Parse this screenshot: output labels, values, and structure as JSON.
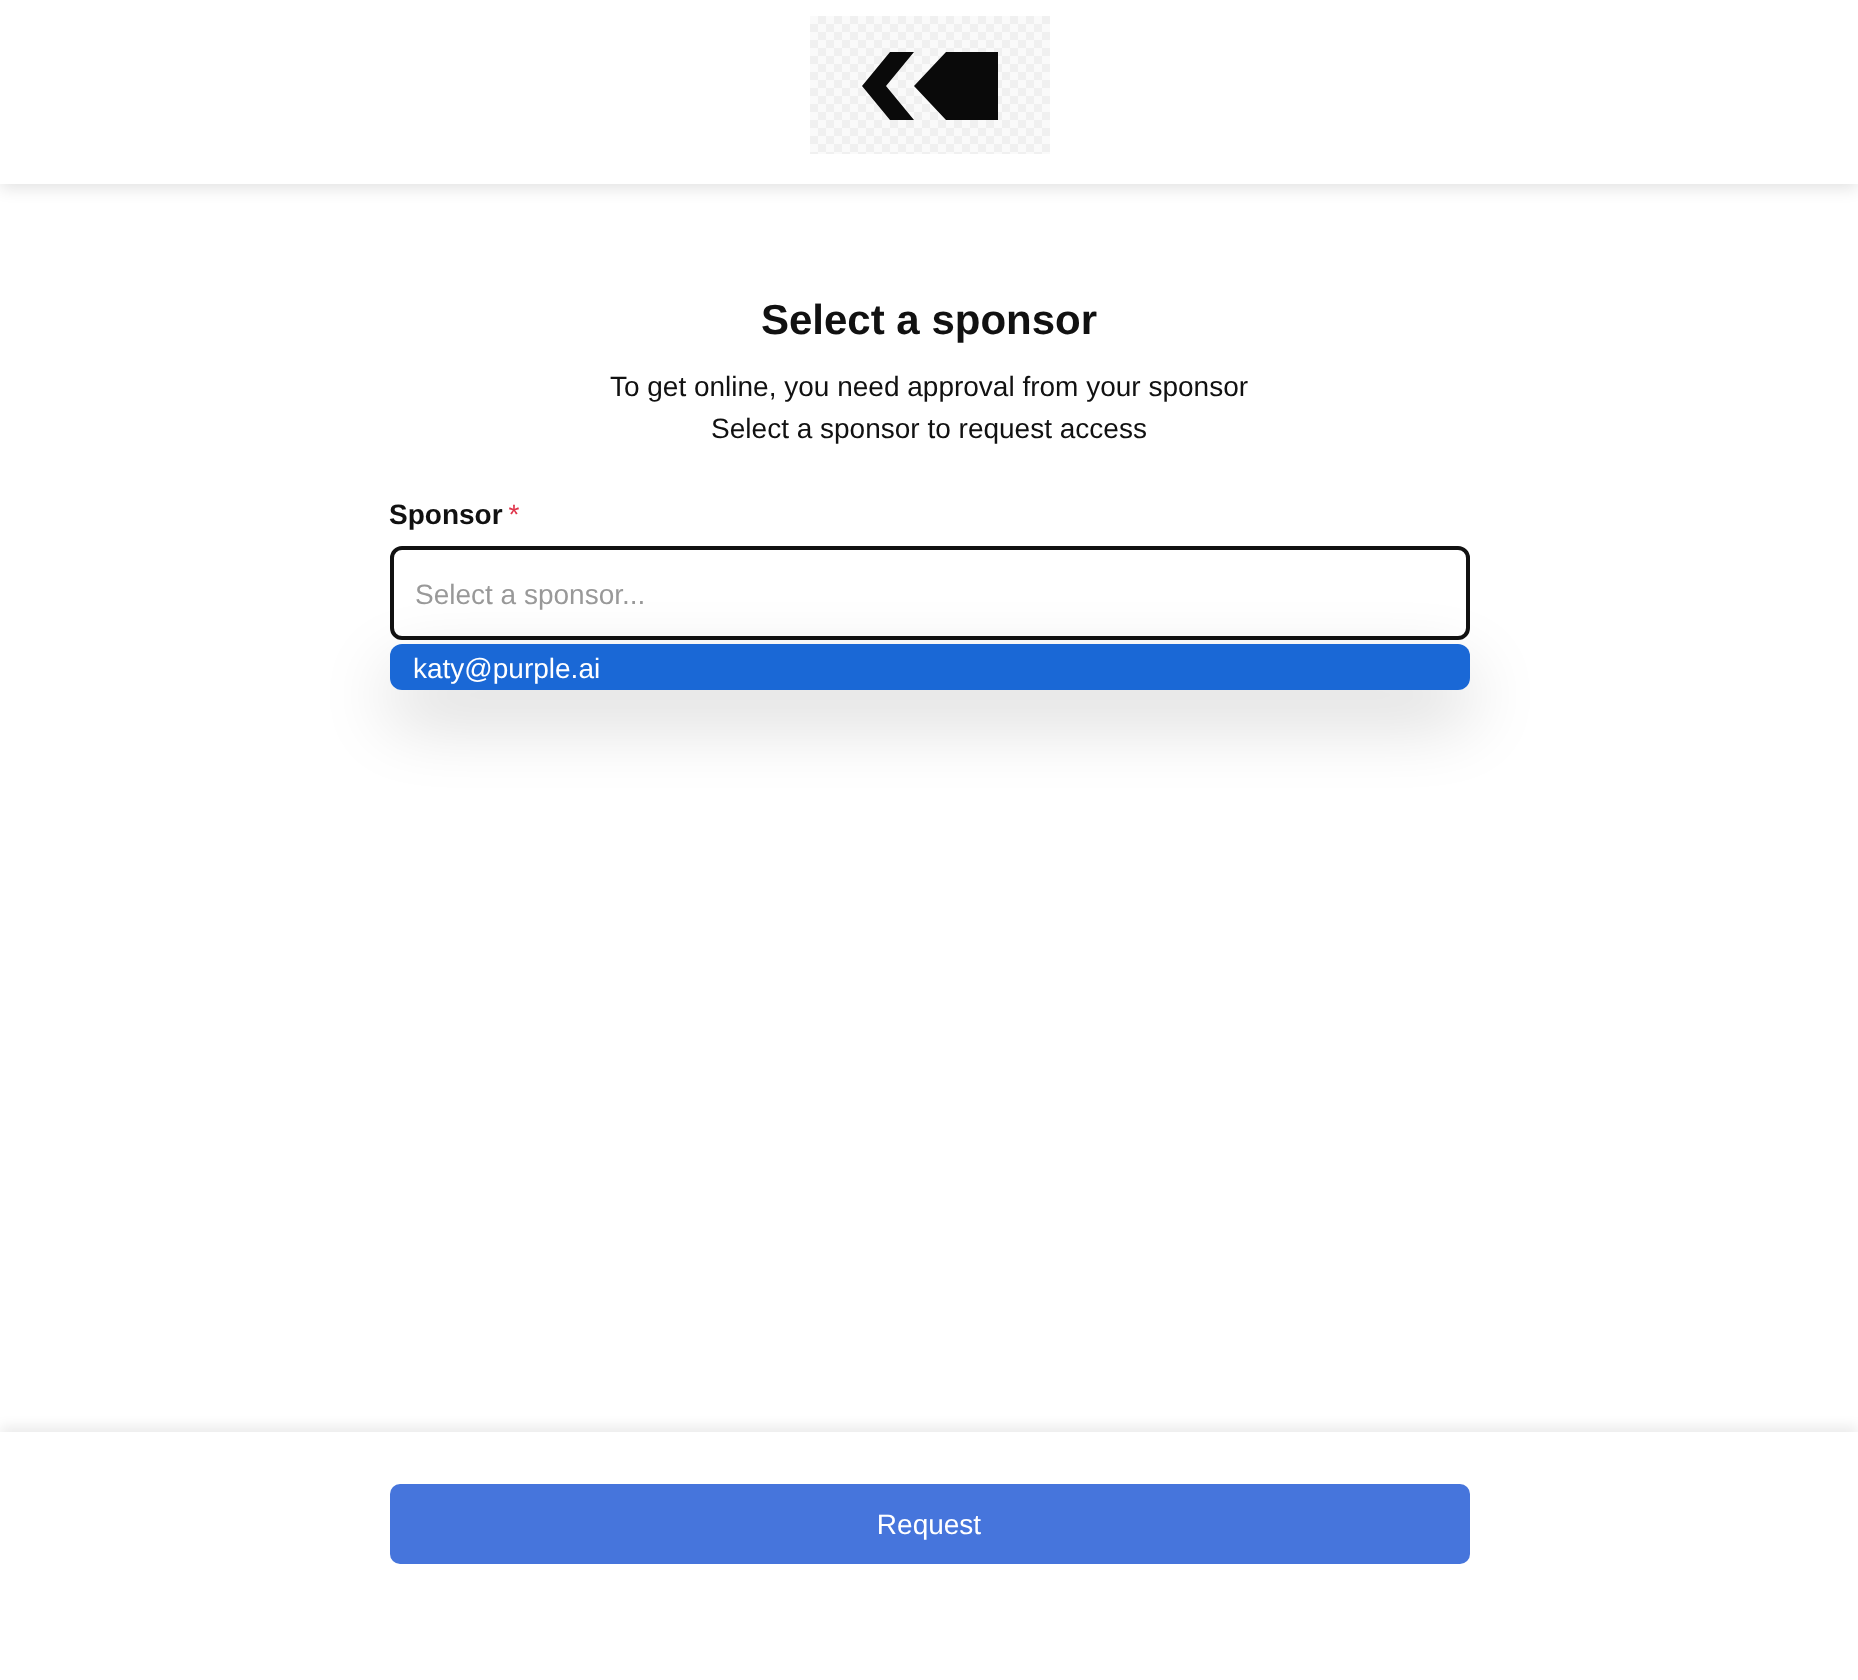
{
  "title": "Select a sponsor",
  "subtitle_lines": [
    "To get online, you need approval from your sponsor",
    "Select a sponsor to request access"
  ],
  "sponsor_field": {
    "label": "Sponsor",
    "required_mark": "*",
    "placeholder": "Select a sponsor...",
    "focused": true
  },
  "options": [
    {
      "label": "katy@purple.ai",
      "selected": true
    }
  ],
  "request_button": "Request"
}
